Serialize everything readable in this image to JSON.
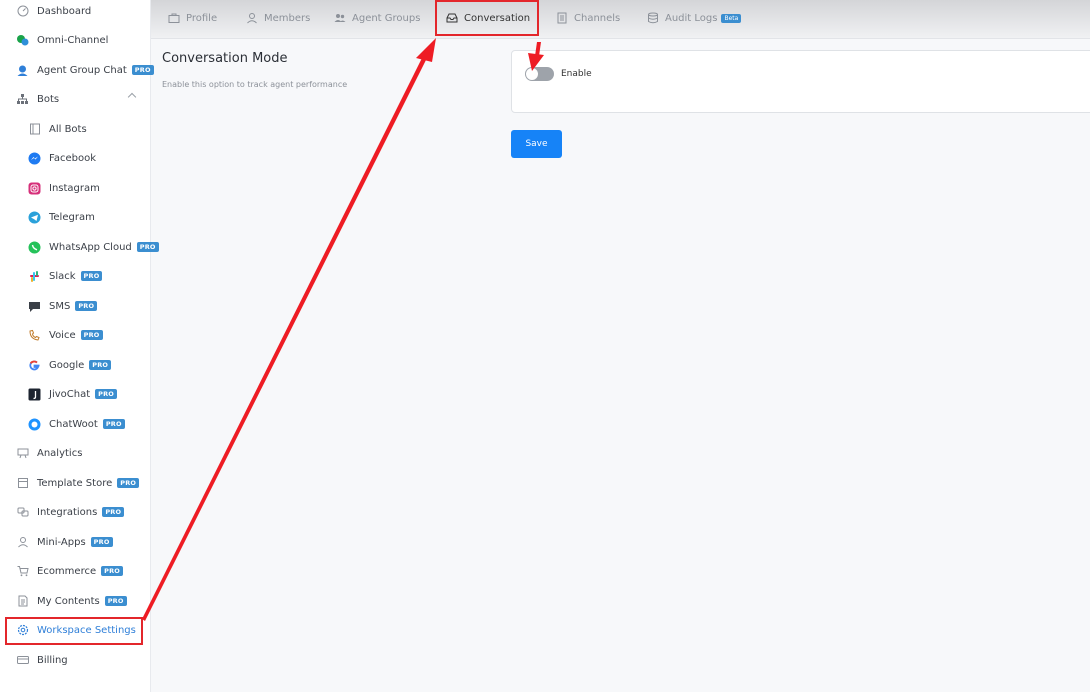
{
  "sidebar": {
    "items": [
      {
        "label": "Dashboard",
        "icon": "dashboard-icon",
        "pro": ""
      },
      {
        "label": "Omni-Channel",
        "icon": "omni-channel-icon",
        "pro": ""
      },
      {
        "label": "Agent Group Chat",
        "icon": "agent-icon",
        "pro": "PRO"
      },
      {
        "label": "Bots",
        "icon": "bots-icon",
        "pro": ""
      },
      {
        "label": "All Bots",
        "icon": "all-bots-icon",
        "pro": ""
      },
      {
        "label": "Facebook",
        "icon": "messenger-icon",
        "pro": ""
      },
      {
        "label": "Instagram",
        "icon": "instagram-icon",
        "pro": ""
      },
      {
        "label": "Telegram",
        "icon": "telegram-icon",
        "pro": ""
      },
      {
        "label": "WhatsApp Cloud",
        "icon": "whatsapp-icon",
        "pro": "PRO"
      },
      {
        "label": "Slack",
        "icon": "slack-icon",
        "pro": "PRO"
      },
      {
        "label": "SMS",
        "icon": "sms-icon",
        "pro": "PRO"
      },
      {
        "label": "Voice",
        "icon": "voice-icon",
        "pro": "PRO"
      },
      {
        "label": "Google",
        "icon": "google-icon",
        "pro": "PRO"
      },
      {
        "label": "JivoChat",
        "icon": "jivochat-icon",
        "pro": "PRO"
      },
      {
        "label": "ChatWoot",
        "icon": "chatwoot-icon",
        "pro": "PRO"
      },
      {
        "label": "Analytics",
        "icon": "analytics-icon",
        "pro": ""
      },
      {
        "label": "Template Store",
        "icon": "template-store-icon",
        "pro": "PRO"
      },
      {
        "label": "Integrations",
        "icon": "integrations-icon",
        "pro": "PRO"
      },
      {
        "label": "Mini-Apps",
        "icon": "mini-apps-icon",
        "pro": "PRO"
      },
      {
        "label": "Ecommerce",
        "icon": "cart-icon",
        "pro": "PRO"
      },
      {
        "label": "My Contents",
        "icon": "document-icon",
        "pro": "PRO"
      },
      {
        "label": "Workspace Settings",
        "icon": "gear-icon",
        "pro": ""
      },
      {
        "label": "Billing",
        "icon": "billing-icon",
        "pro": ""
      }
    ]
  },
  "tabs": [
    {
      "label": "Profile",
      "icon": "briefcase-icon"
    },
    {
      "label": "Members",
      "icon": "user-icon"
    },
    {
      "label": "Agent Groups",
      "icon": "users-icon"
    },
    {
      "label": "Conversation",
      "icon": "inbox-icon"
    },
    {
      "label": "Channels",
      "icon": "channels-icon"
    },
    {
      "label": "Audit Logs",
      "icon": "database-icon",
      "badge": "Beta"
    }
  ],
  "content": {
    "title": "Conversation Mode",
    "description": "Enable this option to track agent performance",
    "toggle_label": "Enable",
    "toggle_on": false,
    "save_label": "Save"
  },
  "colors": {
    "accent": "#1683f7",
    "pro_badge": "#3b8ed0",
    "annotation": "#e3262b"
  }
}
